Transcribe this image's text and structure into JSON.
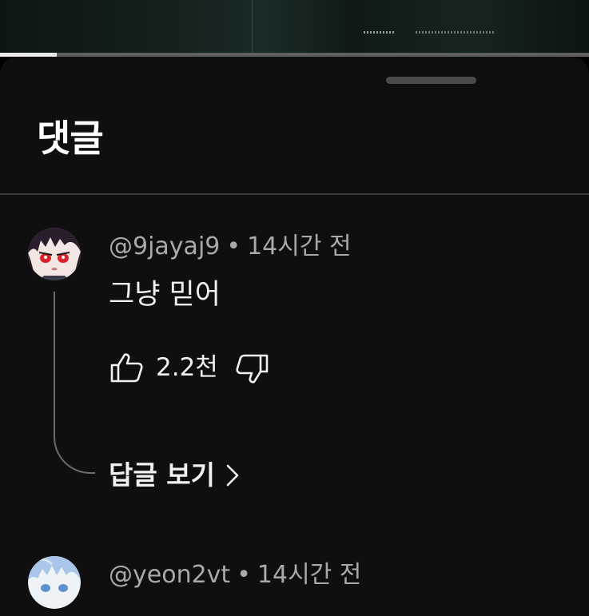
{
  "video": {
    "progress_fraction": 0.096
  },
  "comments_sheet": {
    "title": "댓글"
  },
  "comments": [
    {
      "author": "@9jayaj9",
      "separator": "•",
      "time": "14시간 전",
      "text": "그냥 믿어",
      "likes": "2.2천",
      "replies_label": "답글 보기",
      "avatar_icon": "anime-avatar-dark-hair"
    },
    {
      "author": "@yeon2vt",
      "separator": "•",
      "time": "14시간 전",
      "avatar_icon": "anime-avatar-blue-hair"
    }
  ],
  "icons": {
    "like": "thumbs-up-icon",
    "dislike": "thumbs-down-icon",
    "chevron": "chevron-right-icon"
  },
  "colors": {
    "sheet_background": "#0f0f0f",
    "text_primary": "#f1f1f1",
    "text_secondary": "#a9a9a9"
  }
}
